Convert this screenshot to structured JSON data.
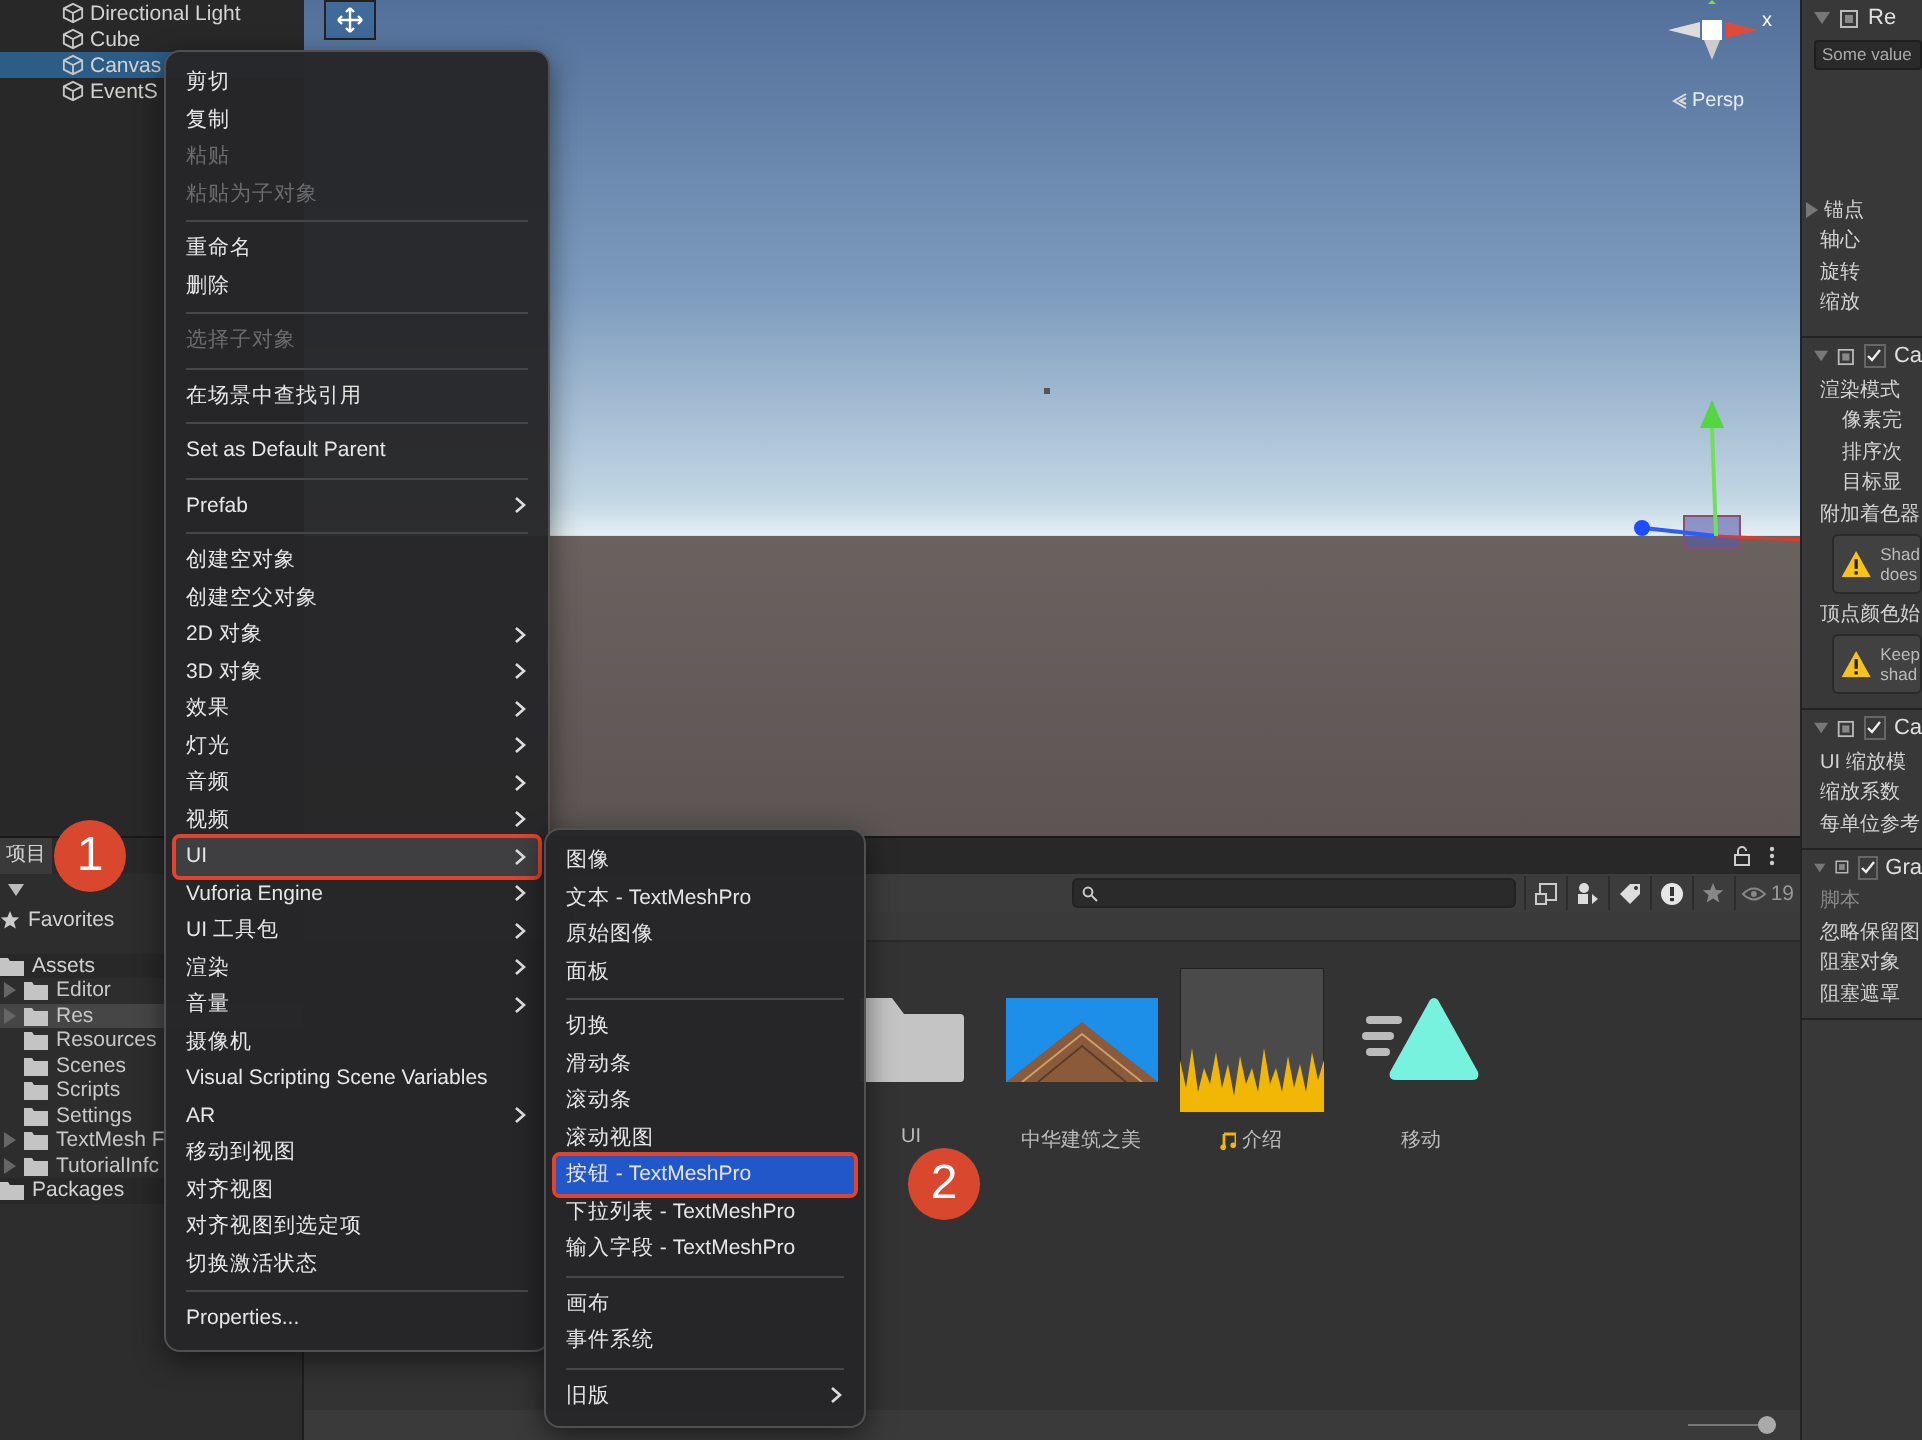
{
  "hierarchy": {
    "items": [
      {
        "label": "Directional Light",
        "selected": false
      },
      {
        "label": "Cube",
        "selected": false
      },
      {
        "label": "Canvas",
        "selected": true
      },
      {
        "label": "EventS",
        "selected": false
      }
    ]
  },
  "scene": {
    "axis_label": "x",
    "projection": "Persp"
  },
  "context_menu": {
    "groups": [
      {
        "items": [
          {
            "label": "剪切",
            "disabled": false,
            "submenu": false,
            "selected": false
          },
          {
            "label": "复制",
            "disabled": false,
            "submenu": false,
            "selected": false
          },
          {
            "label": "粘贴",
            "disabled": true,
            "submenu": false,
            "selected": false
          },
          {
            "label": "粘贴为子对象",
            "disabled": true,
            "submenu": false,
            "selected": false
          }
        ]
      },
      {
        "items": [
          {
            "label": "重命名",
            "disabled": false,
            "submenu": false,
            "selected": false
          },
          {
            "label": "删除",
            "disabled": false,
            "submenu": false,
            "selected": false
          }
        ]
      },
      {
        "items": [
          {
            "label": "选择子对象",
            "disabled": true,
            "submenu": false,
            "selected": false
          }
        ]
      },
      {
        "items": [
          {
            "label": "在场景中查找引用",
            "disabled": false,
            "submenu": false,
            "selected": false
          }
        ]
      },
      {
        "items": [
          {
            "label": "Set as Default Parent",
            "disabled": false,
            "submenu": false,
            "selected": false
          }
        ]
      },
      {
        "items": [
          {
            "label": "Prefab",
            "disabled": false,
            "submenu": true,
            "selected": false
          }
        ]
      },
      {
        "items": [
          {
            "label": "创建空对象",
            "disabled": false,
            "submenu": false,
            "selected": false
          },
          {
            "label": "创建空父对象",
            "disabled": false,
            "submenu": false,
            "selected": false
          },
          {
            "label": "2D 对象",
            "disabled": false,
            "submenu": true,
            "selected": false
          },
          {
            "label": "3D 对象",
            "disabled": false,
            "submenu": true,
            "selected": false
          },
          {
            "label": "效果",
            "disabled": false,
            "submenu": true,
            "selected": false
          },
          {
            "label": "灯光",
            "disabled": false,
            "submenu": true,
            "selected": false
          },
          {
            "label": "音频",
            "disabled": false,
            "submenu": true,
            "selected": false
          },
          {
            "label": "视频",
            "disabled": false,
            "submenu": true,
            "selected": false
          },
          {
            "label": "UI",
            "disabled": false,
            "submenu": true,
            "selected": true
          },
          {
            "label": "Vuforia Engine",
            "disabled": false,
            "submenu": true,
            "selected": false
          },
          {
            "label": "UI 工具包",
            "disabled": false,
            "submenu": true,
            "selected": false
          },
          {
            "label": "渲染",
            "disabled": false,
            "submenu": true,
            "selected": false
          },
          {
            "label": "音量",
            "disabled": false,
            "submenu": true,
            "selected": false
          },
          {
            "label": "摄像机",
            "disabled": false,
            "submenu": false,
            "selected": false
          },
          {
            "label": "Visual Scripting Scene Variables",
            "disabled": false,
            "submenu": false,
            "selected": false
          },
          {
            "label": "AR",
            "disabled": false,
            "submenu": true,
            "selected": false
          },
          {
            "label": "移动到视图",
            "disabled": false,
            "submenu": false,
            "selected": false
          },
          {
            "label": "对齐视图",
            "disabled": false,
            "submenu": false,
            "selected": false
          },
          {
            "label": "对齐视图到选定项",
            "disabled": false,
            "submenu": false,
            "selected": false
          },
          {
            "label": "切换激活状态",
            "disabled": false,
            "submenu": false,
            "selected": false
          }
        ]
      },
      {
        "items": [
          {
            "label": "Properties...",
            "disabled": false,
            "submenu": false,
            "selected": false
          }
        ]
      }
    ]
  },
  "submenu": {
    "groups": [
      {
        "items": [
          {
            "label": "图像",
            "submenu": false,
            "selected": false
          },
          {
            "label": "文本 - TextMeshPro",
            "submenu": false,
            "selected": false
          },
          {
            "label": "原始图像",
            "submenu": false,
            "selected": false
          },
          {
            "label": "面板",
            "submenu": false,
            "selected": false
          }
        ]
      },
      {
        "items": [
          {
            "label": "切换",
            "submenu": false,
            "selected": false
          },
          {
            "label": "滑动条",
            "submenu": false,
            "selected": false
          },
          {
            "label": "滚动条",
            "submenu": false,
            "selected": false
          },
          {
            "label": "滚动视图",
            "submenu": false,
            "selected": false
          },
          {
            "label": "按钮 - TextMeshPro",
            "submenu": false,
            "selected": true
          },
          {
            "label": "下拉列表 - TextMeshPro",
            "submenu": false,
            "selected": false
          },
          {
            "label": "输入字段 - TextMeshPro",
            "submenu": false,
            "selected": false
          }
        ]
      },
      {
        "items": [
          {
            "label": "画布",
            "submenu": false,
            "selected": false
          },
          {
            "label": "事件系统",
            "submenu": false,
            "selected": false
          }
        ]
      },
      {
        "items": [
          {
            "label": "旧版",
            "submenu": true,
            "selected": false
          }
        ]
      }
    ]
  },
  "annotations": [
    {
      "label": "1"
    },
    {
      "label": "2"
    }
  ],
  "project": {
    "tab": "项目",
    "tree": [
      {
        "label": "Favorites",
        "kind": "favorites",
        "expandable": false
      },
      {
        "label": "Assets",
        "kind": "folder",
        "expandable": false,
        "children": [
          {
            "label": "Editor",
            "kind": "folder",
            "expandable": true,
            "selected": false
          },
          {
            "label": "Res",
            "kind": "folder",
            "expandable": true,
            "selected": true
          },
          {
            "label": "Resources",
            "kind": "folder",
            "expandable": false,
            "selected": false
          },
          {
            "label": "Scenes",
            "kind": "folder",
            "expandable": false,
            "selected": false
          },
          {
            "label": "Scripts",
            "kind": "folder",
            "expandable": false,
            "selected": false
          },
          {
            "label": "Settings",
            "kind": "folder",
            "expandable": false,
            "selected": false
          },
          {
            "label": "TextMesh F",
            "kind": "folder",
            "expandable": true,
            "selected": false
          },
          {
            "label": "TutorialInfc",
            "kind": "folder",
            "expandable": true,
            "selected": false
          }
        ]
      },
      {
        "label": "Packages",
        "kind": "folder",
        "expandable": false
      }
    ],
    "hidden_count": "19",
    "assets": [
      {
        "label": "UI",
        "kind": "folder"
      },
      {
        "label": "中华建筑之美",
        "kind": "image"
      },
      {
        "label": "介绍",
        "kind": "audio"
      },
      {
        "label": "移动",
        "kind": "sprite"
      }
    ],
    "zoom": {
      "level": 0.9
    }
  },
  "inspector": {
    "components": [
      {
        "title": "Re",
        "rows": [
          {
            "kind": "field",
            "label": "Some value"
          },
          {
            "kind": "foldout",
            "label": "锚点"
          },
          {
            "kind": "label",
            "label": "轴心"
          },
          {
            "kind": "label",
            "label": "旋转"
          },
          {
            "kind": "label",
            "label": "缩放"
          }
        ]
      },
      {
        "title": "Ca",
        "checked": true,
        "rows": [
          {
            "kind": "label",
            "label": "渲染模式"
          },
          {
            "kind": "indent",
            "label": "像素完"
          },
          {
            "kind": "indent",
            "label": "排序次"
          },
          {
            "kind": "indent",
            "label": "目标显"
          },
          {
            "kind": "label",
            "label": "附加着色器"
          },
          {
            "kind": "warning",
            "lines": [
              "Shad",
              "does"
            ]
          },
          {
            "kind": "label",
            "label": "顶点颜色始"
          },
          {
            "kind": "warning",
            "lines": [
              "Keep",
              "shad"
            ]
          }
        ]
      },
      {
        "title": "Ca",
        "checked": true,
        "rows": [
          {
            "kind": "label",
            "label": "UI 缩放模"
          },
          {
            "kind": "label",
            "label": "缩放系数"
          },
          {
            "kind": "label",
            "label": "每单位参考"
          }
        ]
      },
      {
        "title": "Gra",
        "checked": true,
        "rows": [
          {
            "kind": "dim",
            "label": "脚本"
          },
          {
            "kind": "label",
            "label": "忽略保留图"
          },
          {
            "kind": "label",
            "label": "阻塞对象"
          },
          {
            "kind": "label",
            "label": "阻塞遮罩"
          }
        ]
      }
    ]
  }
}
